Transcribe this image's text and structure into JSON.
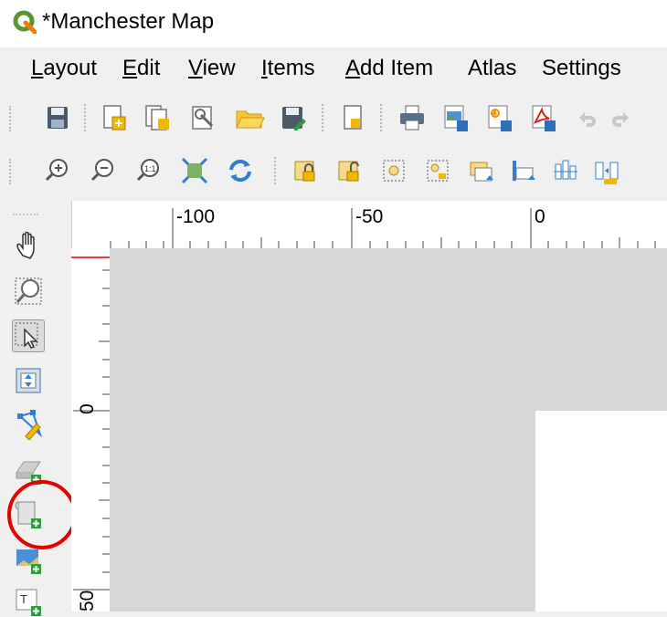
{
  "window": {
    "title": "*Manchester Map",
    "app_icon": "qgis-logo-icon"
  },
  "menubar": {
    "items": [
      {
        "label": "Layout",
        "accel": "L"
      },
      {
        "label": "Edit",
        "accel": "E"
      },
      {
        "label": "View",
        "accel": "V"
      },
      {
        "label": "Items",
        "accel": "I"
      },
      {
        "label": "Add Item",
        "accel": "A"
      },
      {
        "label": "Atlas",
        "accel": ""
      },
      {
        "label": "Settings",
        "accel": ""
      }
    ]
  },
  "toolbar_layout": {
    "icons": [
      "save-layout-icon",
      "new-layout-icon",
      "duplicate-layout-icon",
      "layout-manager-icon",
      "open-template-icon",
      "save-as-template-icon",
      "page-properties-icon",
      "print-icon",
      "export-image-icon",
      "export-svg-icon",
      "export-pdf-icon",
      "undo-icon",
      "redo-icon"
    ]
  },
  "toolbar_view": {
    "icons": [
      "zoom-in-icon",
      "zoom-out-icon",
      "zoom-actual-icon",
      "zoom-full-icon",
      "refresh-icon",
      "lock-items-icon",
      "unlock-items-icon",
      "group-items-icon",
      "ungroup-items-icon",
      "raise-items-icon",
      "lower-items-icon",
      "align-items-icon",
      "distribute-items-icon"
    ]
  },
  "toolbox": {
    "icons": [
      "pan-layout-icon",
      "zoom-tool-icon",
      "select-move-item-icon",
      "move-content-icon",
      "edit-nodes-icon",
      "add-3d-map-icon",
      "add-map-icon",
      "add-picture-icon",
      "add-label-icon"
    ],
    "selected": "select-move-item-icon",
    "highlighted": "add-map-icon",
    "highlight_color": "#e60000"
  },
  "ruler": {
    "horizontal_labels": [
      "-100",
      "-50",
      "0"
    ],
    "vertical_labels": [
      "0",
      "50"
    ]
  },
  "colors": {
    "canvas": "#d7d7d7",
    "page": "#ffffff",
    "highlight": "#e60000",
    "accent": "#2f7fd0"
  }
}
